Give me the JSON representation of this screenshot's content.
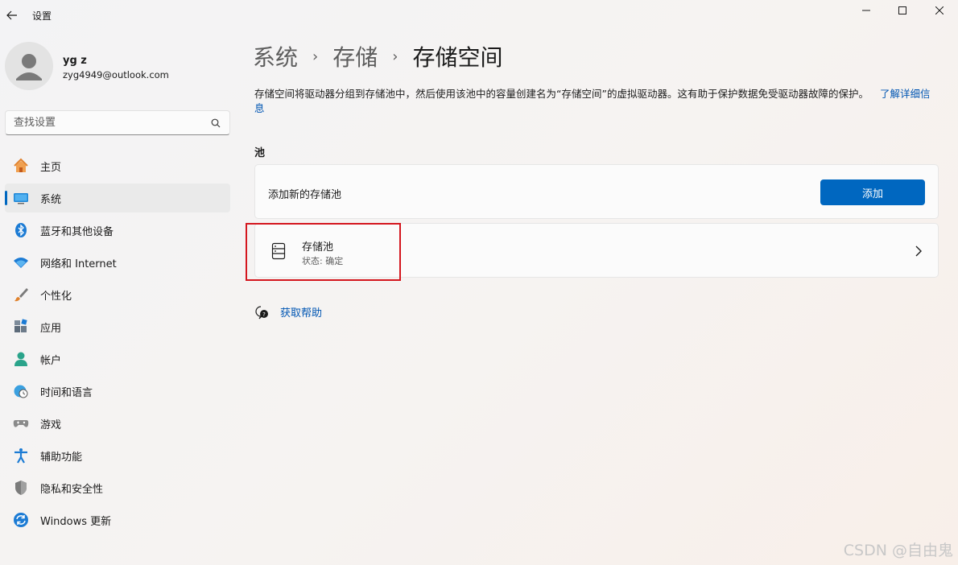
{
  "app": {
    "title": "设置"
  },
  "profile": {
    "name": "yg z",
    "email": "zyg4949@outlook.com"
  },
  "search": {
    "placeholder": "查找设置"
  },
  "nav": {
    "items": [
      {
        "label": "主页",
        "icon": "home-icon"
      },
      {
        "label": "系统",
        "icon": "system-icon",
        "active": true
      },
      {
        "label": "蓝牙和其他设备",
        "icon": "bluetooth-icon"
      },
      {
        "label": "网络和 Internet",
        "icon": "wifi-icon"
      },
      {
        "label": "个性化",
        "icon": "brush-icon"
      },
      {
        "label": "应用",
        "icon": "apps-icon"
      },
      {
        "label": "帐户",
        "icon": "account-icon"
      },
      {
        "label": "时间和语言",
        "icon": "globe-clock-icon"
      },
      {
        "label": "游戏",
        "icon": "gamepad-icon"
      },
      {
        "label": "辅助功能",
        "icon": "accessibility-icon"
      },
      {
        "label": "隐私和安全性",
        "icon": "shield-icon"
      },
      {
        "label": "Windows 更新",
        "icon": "update-icon"
      }
    ]
  },
  "breadcrumb": {
    "level1": "系统",
    "level2": "存储",
    "current": "存储空间",
    "separator": "›"
  },
  "description": {
    "text": "存储空间将驱动器分组到存储池中，然后使用该池中的容量创建名为“存储空间”的虚拟驱动器。这有助于保护数据免受驱动器故障的保护。",
    "link": "了解详细信息"
  },
  "pools_section": {
    "title": "池",
    "add_label": "添加新的存储池",
    "add_button": "添加",
    "pool": {
      "name": "存储池",
      "status": "状态: 确定"
    }
  },
  "help": {
    "label": "获取帮助"
  },
  "watermark": "CSDN @自由鬼",
  "colors": {
    "accent": "#0067c0",
    "highlight": "#d4161e",
    "link": "#0056b3"
  }
}
